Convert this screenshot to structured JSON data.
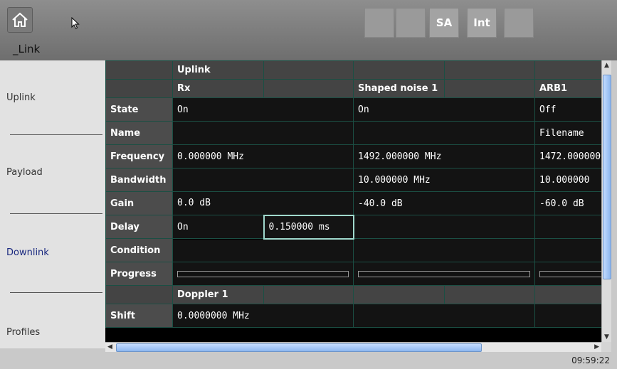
{
  "app": {
    "title": "_Link"
  },
  "toolbar": {
    "buttons": [
      {
        "label": ""
      },
      {
        "label": ""
      },
      {
        "label": "SA"
      },
      {
        "label": "Int"
      },
      {
        "label": ""
      }
    ]
  },
  "sidebar": {
    "items": [
      {
        "label": "Uplink"
      },
      {
        "label": "Payload"
      },
      {
        "label": "Downlink"
      },
      {
        "label": "Profiles"
      }
    ]
  },
  "grid": {
    "header1": {
      "uplink": "Uplink"
    },
    "header2": {
      "rx": "Rx",
      "shaped_noise": "Shaped noise 1",
      "arb": "ARB1"
    },
    "rows": {
      "state": {
        "label": "State",
        "rx": "On",
        "noise": "On",
        "arb": "Off"
      },
      "name": {
        "label": "Name",
        "arb": "Filename"
      },
      "frequency": {
        "label": "Frequency",
        "rx": "0.000000 MHz",
        "noise": "1492.000000 MHz",
        "arb": "1472.000000"
      },
      "bandwidth": {
        "label": "Bandwidth",
        "noise": "10.000000 MHz",
        "arb": "10.000000"
      },
      "gain": {
        "label": "Gain",
        "rx": "0.0 dB",
        "noise": "-40.0 dB",
        "arb": "-60.0 dB"
      },
      "delay": {
        "label": "Delay",
        "rx": "On",
        "rx_value": "0.150000 ms"
      },
      "condition": {
        "label": "Condition"
      },
      "progress": {
        "label": "Progress"
      }
    },
    "doppler_header": "Doppler 1",
    "shift": {
      "label": "Shift",
      "value": "0.0000000 MHz"
    }
  },
  "status": {
    "clock": "09:59:22"
  }
}
